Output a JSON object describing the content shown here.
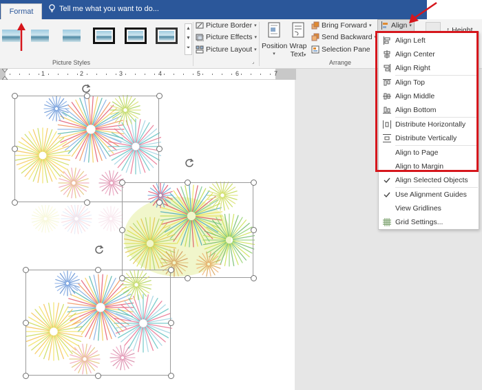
{
  "tabs": {
    "active": "Format",
    "tell_me": "Tell me what you want to do..."
  },
  "ribbon": {
    "picture_styles_label": "Picture Styles",
    "arrange_label": "Arrange",
    "picture_border": "Picture Border",
    "picture_effects": "Picture Effects",
    "picture_layout": "Picture Layout",
    "position": "Position",
    "wrap_text_line1": "Wrap",
    "wrap_text_line2": "Text",
    "bring_forward": "Bring Forward",
    "send_backward": "Send Backward",
    "selection_pane": "Selection Pane",
    "align": "Align",
    "height": "Height"
  },
  "ruler": {
    "numbers": [
      "1",
      "2",
      "3",
      "4",
      "5",
      "6",
      "7"
    ]
  },
  "align_menu": {
    "items": [
      {
        "label": "Align Left",
        "icon": "align-left-icon"
      },
      {
        "label": "Align Center",
        "icon": "align-center-icon"
      },
      {
        "label": "Align Right",
        "icon": "align-right-icon"
      },
      {
        "label": "Align Top",
        "icon": "align-top-icon"
      },
      {
        "label": "Align Middle",
        "icon": "align-middle-icon"
      },
      {
        "label": "Align Bottom",
        "icon": "align-bottom-icon"
      },
      {
        "label": "Distribute Horizontally",
        "icon": "distribute-horizontal-icon"
      },
      {
        "label": "Distribute Vertically",
        "icon": "distribute-vertical-icon"
      },
      {
        "label": "Align to Page",
        "icon": ""
      },
      {
        "label": "Align to Margin",
        "icon": ""
      },
      {
        "label": "Align Selected Objects",
        "icon": "checkmark-icon"
      },
      {
        "label": "Use Alignment Guides",
        "icon": "checkmark-icon"
      },
      {
        "label": "View Gridlines",
        "icon": ""
      },
      {
        "label": "Grid Settings...",
        "icon": "grid-icon"
      }
    ]
  },
  "colors": {
    "title_bar": "#2b579a",
    "highlight": "#d6161c",
    "accent_text": "#2b579a"
  }
}
